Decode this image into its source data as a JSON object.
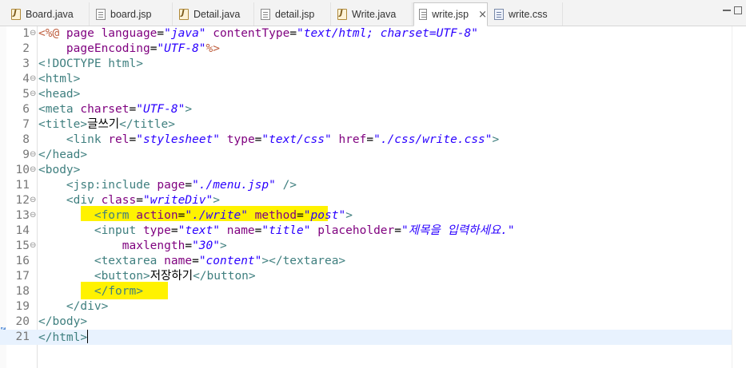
{
  "tabs": [
    {
      "label": "Board.java",
      "icon": "java-file-icon",
      "active": false
    },
    {
      "label": "board.jsp",
      "icon": "jsp-file-icon",
      "active": false
    },
    {
      "label": "Detail.java",
      "icon": "java-file-icon",
      "active": false
    },
    {
      "label": "detail.jsp",
      "icon": "jsp-file-icon",
      "active": false
    },
    {
      "label": "Write.java",
      "icon": "java-file-icon",
      "active": false
    },
    {
      "label": "write.jsp",
      "icon": "jsp-file-icon",
      "active": true,
      "close": "×"
    },
    {
      "label": "write.css",
      "icon": "css-file-icon",
      "active": false
    }
  ],
  "colors": {
    "tag": "#3f7f7f",
    "attr": "#7f007f",
    "value": "#2a00ff",
    "directive": "#bf5f3f",
    "highlight": "#fff200",
    "current_line": "#e8f2fe"
  },
  "editor": {
    "current_line": 21,
    "lines": [
      {
        "num": "1",
        "fold": "⊖",
        "tokens": [
          {
            "t": "dir",
            "v": "<%@ "
          },
          {
            "t": "attr",
            "v": "page "
          },
          {
            "t": "attr",
            "v": "language"
          },
          {
            "t": "text",
            "v": "="
          },
          {
            "t": "val",
            "v": "\"java\""
          },
          {
            "t": "text",
            "v": " "
          },
          {
            "t": "attr",
            "v": "contentType"
          },
          {
            "t": "text",
            "v": "="
          },
          {
            "t": "val",
            "v": "\"text/html; charset=UTF-8\""
          }
        ]
      },
      {
        "num": "2",
        "fold": "",
        "tokens": [
          {
            "t": "text",
            "v": "    "
          },
          {
            "t": "attr",
            "v": "pageEncoding"
          },
          {
            "t": "text",
            "v": "="
          },
          {
            "t": "val",
            "v": "\"UTF-8\""
          },
          {
            "t": "dir",
            "v": "%>"
          }
        ]
      },
      {
        "num": "3",
        "fold": "",
        "tokens": [
          {
            "t": "tag",
            "v": "<!DOCTYPE html>"
          }
        ]
      },
      {
        "num": "4",
        "fold": "⊖",
        "tokens": [
          {
            "t": "tag",
            "v": "<html>"
          }
        ]
      },
      {
        "num": "5",
        "fold": "⊖",
        "tokens": [
          {
            "t": "tag",
            "v": "<head>"
          }
        ]
      },
      {
        "num": "6",
        "fold": "",
        "tokens": [
          {
            "t": "tag",
            "v": "<meta "
          },
          {
            "t": "attr",
            "v": "charset"
          },
          {
            "t": "text",
            "v": "="
          },
          {
            "t": "val",
            "v": "\"UTF-8\""
          },
          {
            "t": "tag",
            "v": ">"
          }
        ]
      },
      {
        "num": "7",
        "fold": "",
        "tokens": [
          {
            "t": "tag",
            "v": "<title>"
          },
          {
            "t": "text",
            "v": "글쓰기"
          },
          {
            "t": "tag",
            "v": "</title>"
          }
        ]
      },
      {
        "num": "8",
        "fold": "",
        "tokens": [
          {
            "t": "text",
            "v": "    "
          },
          {
            "t": "tag",
            "v": "<link "
          },
          {
            "t": "attr",
            "v": "rel"
          },
          {
            "t": "text",
            "v": "="
          },
          {
            "t": "val",
            "v": "\"stylesheet\""
          },
          {
            "t": "text",
            "v": " "
          },
          {
            "t": "attr",
            "v": "type"
          },
          {
            "t": "text",
            "v": "="
          },
          {
            "t": "val",
            "v": "\"text/css\""
          },
          {
            "t": "text",
            "v": " "
          },
          {
            "t": "attr",
            "v": "href"
          },
          {
            "t": "text",
            "v": "="
          },
          {
            "t": "val",
            "v": "\"./css/write.css\""
          },
          {
            "t": "tag",
            "v": ">"
          }
        ]
      },
      {
        "num": "9",
        "fold": "⊖",
        "tokens": [
          {
            "t": "tag",
            "v": "</head>"
          }
        ]
      },
      {
        "num": "10",
        "fold": "⊖",
        "tokens": [
          {
            "t": "tag",
            "v": "<body>"
          }
        ]
      },
      {
        "num": "11",
        "fold": "",
        "tokens": [
          {
            "t": "text",
            "v": "    "
          },
          {
            "t": "tag",
            "v": "<jsp:include "
          },
          {
            "t": "attr",
            "v": "page"
          },
          {
            "t": "text",
            "v": "="
          },
          {
            "t": "val",
            "v": "\"./menu.jsp\""
          },
          {
            "t": "text",
            "v": " "
          },
          {
            "t": "tag",
            "v": "/>"
          }
        ]
      },
      {
        "num": "12",
        "fold": "⊖",
        "tokens": [
          {
            "t": "text",
            "v": "    "
          },
          {
            "t": "tag",
            "v": "<div "
          },
          {
            "t": "attr",
            "v": "class"
          },
          {
            "t": "text",
            "v": "="
          },
          {
            "t": "val",
            "v": "\"writeDiv\""
          },
          {
            "t": "tag",
            "v": ">"
          }
        ]
      },
      {
        "num": "13",
        "fold": "⊖",
        "tokens": [
          {
            "t": "text",
            "v": "        "
          },
          {
            "t": "tag",
            "v": "<form "
          },
          {
            "t": "attr",
            "v": "action"
          },
          {
            "t": "text",
            "v": "="
          },
          {
            "t": "val",
            "v": "\"./write\""
          },
          {
            "t": "text",
            "v": " "
          },
          {
            "t": "attr",
            "v": "method"
          },
          {
            "t": "text",
            "v": "="
          },
          {
            "t": "val",
            "v": "\"post\""
          },
          {
            "t": "tag",
            "v": ">"
          }
        ]
      },
      {
        "num": "14",
        "fold": "",
        "tokens": [
          {
            "t": "text",
            "v": "        "
          },
          {
            "t": "tag",
            "v": "<input "
          },
          {
            "t": "attr",
            "v": "type"
          },
          {
            "t": "text",
            "v": "="
          },
          {
            "t": "val",
            "v": "\"text\""
          },
          {
            "t": "text",
            "v": " "
          },
          {
            "t": "attr",
            "v": "name"
          },
          {
            "t": "text",
            "v": "="
          },
          {
            "t": "val",
            "v": "\"title\""
          },
          {
            "t": "text",
            "v": " "
          },
          {
            "t": "attr",
            "v": "placeholder"
          },
          {
            "t": "text",
            "v": "="
          },
          {
            "t": "val",
            "v": "\"제목을 입력하세요.\""
          }
        ]
      },
      {
        "num": "15",
        "fold": "⊖",
        "tokens": [
          {
            "t": "text",
            "v": "            "
          },
          {
            "t": "attr",
            "v": "maxlength"
          },
          {
            "t": "text",
            "v": "="
          },
          {
            "t": "val",
            "v": "\"30\""
          },
          {
            "t": "tag",
            "v": ">"
          }
        ]
      },
      {
        "num": "16",
        "fold": "",
        "tokens": [
          {
            "t": "text",
            "v": "        "
          },
          {
            "t": "tag",
            "v": "<textarea "
          },
          {
            "t": "attr",
            "v": "name"
          },
          {
            "t": "text",
            "v": "="
          },
          {
            "t": "val",
            "v": "\"content\""
          },
          {
            "t": "tag",
            "v": "></textarea>"
          }
        ]
      },
      {
        "num": "17",
        "fold": "",
        "tokens": [
          {
            "t": "text",
            "v": "        "
          },
          {
            "t": "tag",
            "v": "<button>"
          },
          {
            "t": "text",
            "v": "저장하기"
          },
          {
            "t": "tag",
            "v": "</button>"
          }
        ]
      },
      {
        "num": "18",
        "fold": "",
        "tokens": [
          {
            "t": "text",
            "v": "        "
          },
          {
            "t": "tag",
            "v": "</form>"
          }
        ]
      },
      {
        "num": "19",
        "fold": "",
        "tokens": [
          {
            "t": "text",
            "v": "    "
          },
          {
            "t": "tag",
            "v": "</div>"
          }
        ]
      },
      {
        "num": "20",
        "fold": "",
        "tokens": [
          {
            "t": "tag",
            "v": "</body>"
          }
        ]
      },
      {
        "num": "21",
        "fold": "",
        "tokens": [
          {
            "t": "tag",
            "v": "</html>"
          }
        ]
      }
    ]
  }
}
